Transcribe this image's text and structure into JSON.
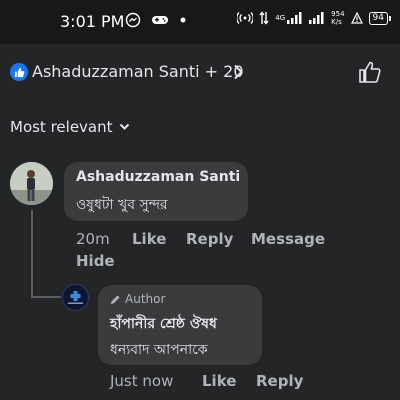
{
  "status_bar": {
    "time": "3:01 PM",
    "left_icons": [
      "messenger-icon",
      "game-controller-icon",
      "dot-icon"
    ],
    "net_type": "4G",
    "speed_value": "954",
    "speed_unit": "K/s",
    "battery": "94"
  },
  "header": {
    "title": "Ashaduzzaman Santi + 20",
    "reaction_icon": "like-badge-icon",
    "accent": "#1877f2"
  },
  "sort": {
    "label": "Most relevant"
  },
  "comments": [
    {
      "name": "Ashaduzzaman Santi",
      "text": "ওষুধটা খুব সুন্দর",
      "time": "20m",
      "like": "Like",
      "reply": "Reply",
      "message": "Message",
      "hide": "Hide"
    }
  ],
  "reply": {
    "author_badge": "Author",
    "name": "হাঁপানীর শ্রেষ্ঠ ঔষধ",
    "text": "ধন্যবাদ আপনাকে",
    "time": "Just now",
    "like": "Like",
    "reply": "Reply"
  },
  "colors": {
    "background": "#242526",
    "bubble": "#3a3b3c",
    "secondary_text": "#b0b3b8"
  }
}
